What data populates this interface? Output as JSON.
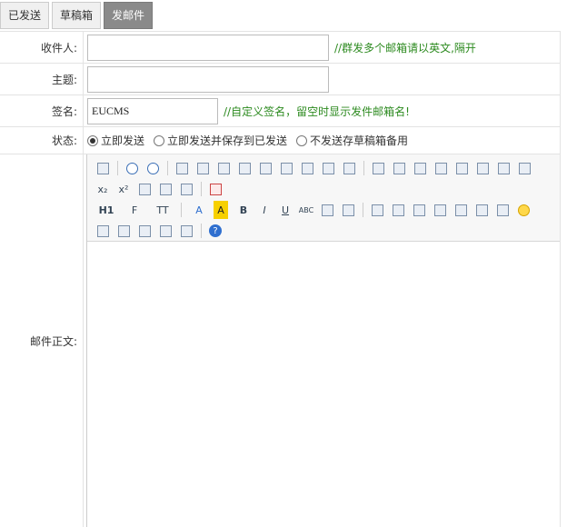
{
  "tabs": [
    {
      "label": "已发送",
      "active": false
    },
    {
      "label": "草稿箱",
      "active": false
    },
    {
      "label": "发邮件",
      "active": true
    }
  ],
  "form": {
    "recipient": {
      "label": "收件人:",
      "value": "",
      "hint": "//群发多个邮箱请以英文,隔开"
    },
    "subject": {
      "label": "主题:",
      "value": ""
    },
    "signature": {
      "label": "签名:",
      "value": "EUCMS",
      "hint": "//自定义签名，留空时显示发件邮箱名!"
    },
    "status": {
      "label": "状态:",
      "options": [
        {
          "label": "立即发送",
          "checked": true
        },
        {
          "label": "立即发送并保存到已发送",
          "checked": false
        },
        {
          "label": "不发送存草稿箱备用",
          "checked": false
        }
      ]
    },
    "body": {
      "label": "邮件正文:"
    }
  },
  "toolbar": {
    "rows": [
      [
        "source-icon",
        "|",
        "undo-icon",
        "redo-icon",
        "|",
        "preview-icon",
        "print-icon",
        "template-icon",
        "code-icon",
        "cut-icon",
        "copy-icon",
        "paste-icon",
        "paste-text-icon",
        "paste-word-icon",
        "|",
        "align-left-icon",
        "align-center-icon",
        "align-right-icon",
        "align-justify-icon",
        "ordered-list-icon",
        "unordered-list-icon",
        "indent-icon",
        "outdent-icon"
      ],
      [
        "subscript-icon",
        "superscript-icon",
        "clear-format-icon",
        "select-all-icon",
        "select-icon",
        "|",
        "fullscreen-icon"
      ],
      [
        "heading-icon",
        "font-family-icon",
        "font-size-icon",
        "|",
        "font-color-icon",
        "highlight-icon",
        "bold-icon",
        "italic-icon",
        "underline-icon",
        "strikethrough-icon",
        "line-height-icon",
        "eraser-icon",
        "|",
        "image-icon",
        "multi-image-icon",
        "flash-icon",
        "media-icon",
        "attachment-icon",
        "table-icon",
        "hr-icon",
        "emoticon-icon"
      ],
      [
        "map-icon",
        "page-break-icon",
        "anchor-icon",
        "link-icon",
        "unlink-icon",
        "|",
        "help-icon"
      ]
    ],
    "glyphs": {
      "heading-icon": "H1",
      "font-family-icon": "F",
      "font-size-icon": "TT",
      "font-color-icon": "A",
      "highlight-icon": "A",
      "bold-icon": "B",
      "italic-icon": "I",
      "underline-icon": "U",
      "strikethrough-icon": "ABC",
      "subscript-icon": "x₂",
      "superscript-icon": "x²",
      "help-icon": "?"
    }
  }
}
